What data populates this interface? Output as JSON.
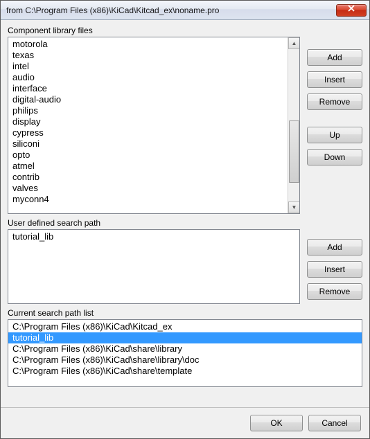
{
  "window": {
    "title": "from C:\\Program Files (x86)\\KiCad\\Kitcad_ex\\noname.pro"
  },
  "sections": {
    "component_libs": {
      "label": "Component library files",
      "items": [
        "motorola",
        "texas",
        "intel",
        "audio",
        "interface",
        "digital-audio",
        "philips",
        "display",
        "cypress",
        "siliconi",
        "opto",
        "atmel",
        "contrib",
        "valves",
        "myconn4"
      ]
    },
    "user_search": {
      "label": "User defined search path",
      "items": [
        "tutorial_lib"
      ]
    },
    "current_paths": {
      "label": "Current search path list",
      "items": [
        "C:\\Program Files (x86)\\KiCad\\Kitcad_ex",
        "tutorial_lib",
        "C:\\Program Files (x86)\\KiCad\\share\\library",
        "C:\\Program Files (x86)\\KiCad\\share\\library\\doc",
        "C:\\Program Files (x86)\\KiCad\\share\\template"
      ],
      "selected_index": 1
    }
  },
  "buttons": {
    "add": "Add",
    "insert": "Insert",
    "remove": "Remove",
    "up": "Up",
    "down": "Down",
    "ok": "OK",
    "cancel": "Cancel"
  }
}
